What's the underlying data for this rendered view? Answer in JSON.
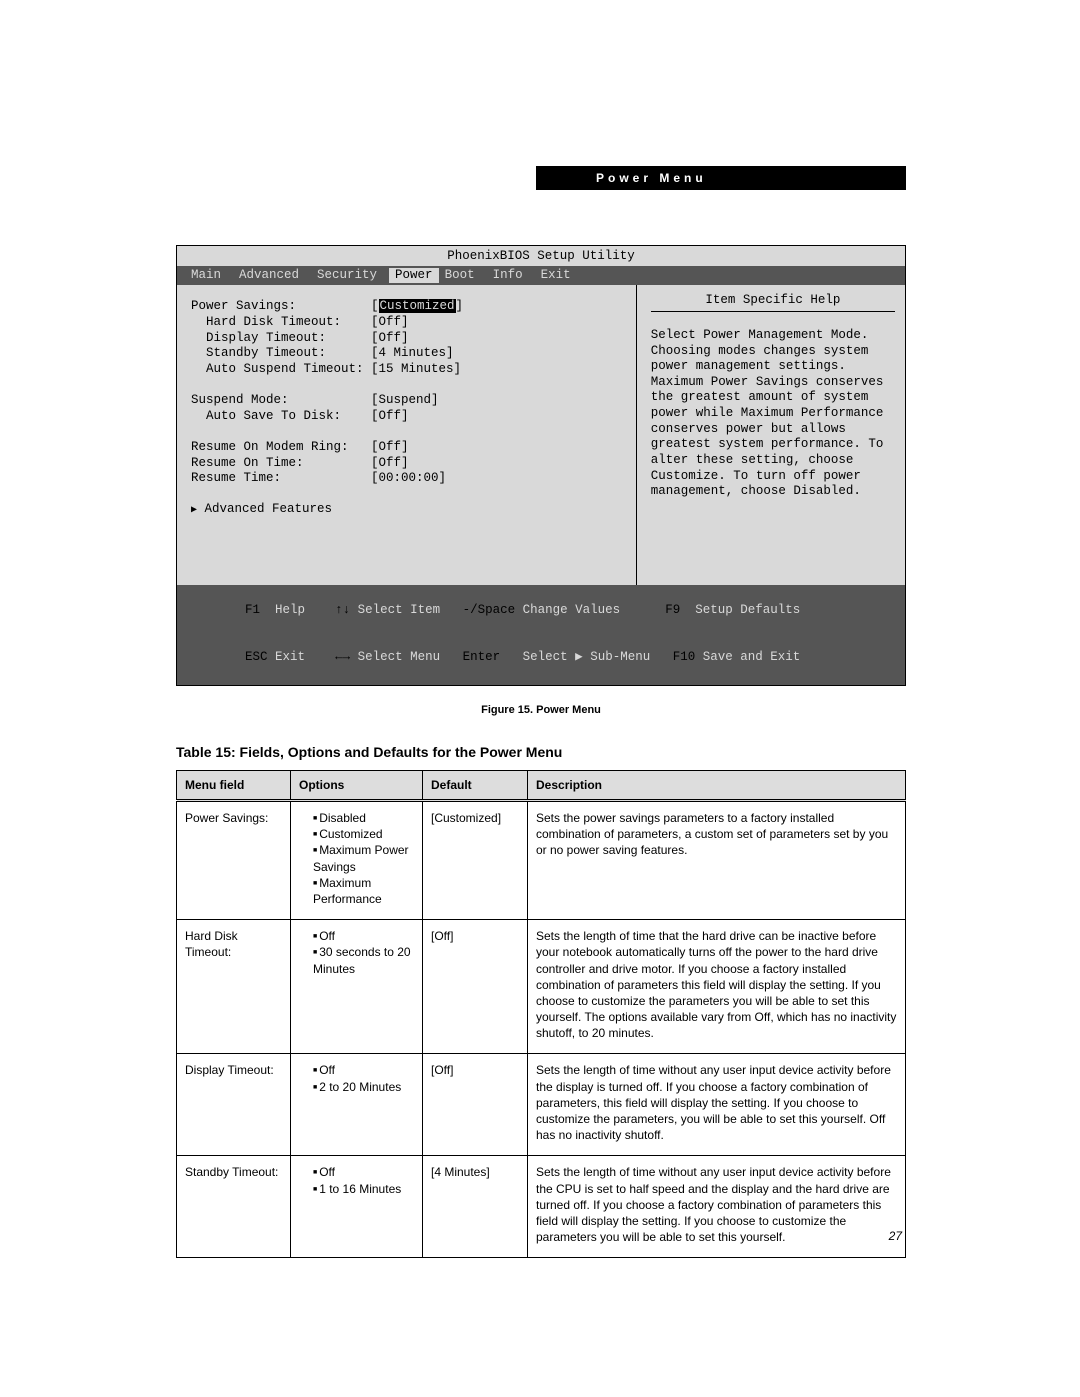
{
  "header": {
    "title": "Power Menu"
  },
  "bios": {
    "title": "PhoenixBIOS Setup Utility",
    "tabs": [
      "Main",
      "Advanced",
      "Security",
      "Power",
      "Boot",
      "Info",
      "Exit"
    ],
    "active_tab": "Power",
    "settings": [
      {
        "label": "Power Savings:",
        "value": "Customized",
        "indent": 0,
        "selected": true,
        "bracket": true
      },
      {
        "label": "Hard Disk Timeout:",
        "value": "[Off]",
        "indent": 1
      },
      {
        "label": "Display Timeout:",
        "value": "[Off]",
        "indent": 1
      },
      {
        "label": "Standby Timeout:",
        "value": "[4 Minutes]",
        "indent": 1
      },
      {
        "label": "Auto Suspend Timeout:",
        "value": "[15 Minutes]",
        "indent": 1
      },
      {
        "spacer": true
      },
      {
        "label": "Suspend Mode:",
        "value": "[Suspend]",
        "indent": 0
      },
      {
        "label": "Auto Save To Disk:",
        "value": "[Off]",
        "indent": 1
      },
      {
        "spacer": true
      },
      {
        "label": "Resume On Modem Ring:",
        "value": "[Off]",
        "indent": 0
      },
      {
        "label": "Resume On Time:",
        "value": "[Off]",
        "indent": 0
      },
      {
        "label": "Resume Time:",
        "value": "[00:00:00]",
        "indent": 0
      },
      {
        "spacer": true
      },
      {
        "label": "Advanced Features",
        "value": "",
        "indent": 0,
        "arrow": true
      }
    ],
    "help_title": "Item Specific Help",
    "help_text": "Select Power Management Mode. Choosing modes changes system power management settings. Maximum Power Savings conserves the greatest amount of system power while Maximum Performance conserves power but allows greatest system performance. To alter these setting, choose Customize. To turn off power management, choose Disabled.",
    "footer": {
      "f1": "F1",
      "help": "Help",
      "arrows_v": "↑↓",
      "select_item": "Select Item",
      "minus_space": "-/Space",
      "change_values": "Change Values",
      "f9": "F9",
      "setup_defaults": "Setup Defaults",
      "esc": "ESC",
      "exit": "Exit",
      "arrows_h": "←→",
      "select_menu": "Select Menu",
      "enter": "Enter",
      "select_submenu": "Select ▶ Sub-Menu",
      "f10": "F10",
      "save_exit": "Save and Exit"
    }
  },
  "figure_caption": "Figure 15. Power Menu",
  "table_title": "Table 15: Fields, Options and Defaults for the Power Menu",
  "table": {
    "headers": [
      "Menu field",
      "Options",
      "Default",
      "Description"
    ],
    "rows": [
      {
        "field": "Power Savings:",
        "options": [
          "Disabled",
          "Customized",
          "Maximum Power Savings",
          "Maximum Performance"
        ],
        "default": "[Customized]",
        "desc": "Sets the power savings parameters to a factory installed combination of parameters, a custom set of parameters set by you or no power saving features."
      },
      {
        "field": "Hard Disk Timeout:",
        "options": [
          "Off",
          "30 seconds to 20 Minutes"
        ],
        "default": "[Off]",
        "desc": "Sets the length of time that the hard drive can be inactive before your notebook automatically turns off the power to the hard drive controller and drive motor. If you choose a factory installed combination of parameters this field will display the setting. If you choose to customize the parameters you will be able to set this yourself. The options available vary from Off, which has no inactivity shutoff, to 20 minutes."
      },
      {
        "field": "Display Timeout:",
        "options": [
          "Off",
          "2 to 20 Minutes"
        ],
        "default": "[Off]",
        "desc": "Sets the length of time without any user input device activity before the display is turned off. If you choose a factory combination of parameters, this field will display the setting. If you choose to customize the parameters, you will be able to set this yourself. Off has no inactivity shutoff."
      },
      {
        "field": "Standby Timeout:",
        "options": [
          "Off",
          "1 to 16 Minutes"
        ],
        "default": "[4 Minutes]",
        "desc": "Sets the length of time without any user input device activity before the CPU is set to half speed and the display and the hard drive are turned off. If you choose a factory combination of parameters this field will display the setting. If you choose to customize the parameters you will be able to set this yourself."
      }
    ]
  },
  "page_number": "27"
}
